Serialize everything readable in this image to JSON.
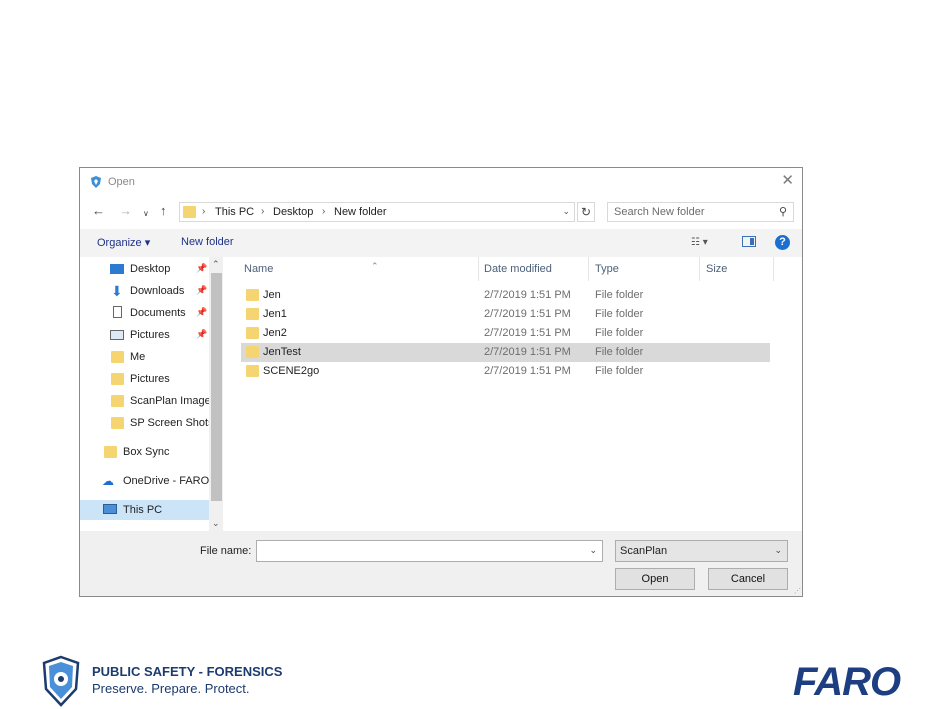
{
  "dialog": {
    "title": "Open",
    "breadcrumb": [
      "This PC",
      "Desktop",
      "New folder"
    ],
    "search_placeholder": "Search New folder",
    "toolbar": {
      "organize": "Organize",
      "new_folder": "New folder"
    },
    "nav_items": [
      {
        "label": "Desktop",
        "icon": "desktop-icon",
        "pinned": true
      },
      {
        "label": "Downloads",
        "icon": "download-arrow-icon",
        "pinned": true
      },
      {
        "label": "Documents",
        "icon": "document-icon",
        "pinned": true
      },
      {
        "label": "Pictures",
        "icon": "picture-icon",
        "pinned": true
      },
      {
        "label": "Me",
        "icon": "folder-icon",
        "pinned": false
      },
      {
        "label": "Pictures",
        "icon": "folder-icon",
        "pinned": false
      },
      {
        "label": "ScanPlan Images",
        "icon": "folder-icon",
        "pinned": false
      },
      {
        "label": "SP Screen Shots",
        "icon": "folder-icon",
        "pinned": false
      },
      {
        "label": "Box Sync",
        "icon": "folder-icon",
        "pinned": false
      },
      {
        "label": "OneDrive - FARO Technologies",
        "icon": "cloud-icon",
        "pinned": false
      },
      {
        "label": "This PC",
        "icon": "computer-icon",
        "pinned": false,
        "selected": true
      }
    ],
    "columns": [
      "Name",
      "Date modified",
      "Type",
      "Size"
    ],
    "files": [
      {
        "name": "Jen",
        "date": "2/7/2019 1:51 PM",
        "type": "File folder"
      },
      {
        "name": "Jen1",
        "date": "2/7/2019 1:51 PM",
        "type": "File folder"
      },
      {
        "name": "Jen2",
        "date": "2/7/2019 1:51 PM",
        "type": "File folder"
      },
      {
        "name": "JenTest",
        "date": "2/7/2019 1:51 PM",
        "type": "File folder",
        "selected": true
      },
      {
        "name": "SCENE2go",
        "date": "2/7/2019 1:51 PM",
        "type": "File folder"
      }
    ],
    "file_name_label": "File name:",
    "file_name_value": "",
    "file_type": "ScanPlan",
    "open_button": "Open",
    "cancel_button": "Cancel",
    "colors": {
      "folder": "#f5d571",
      "accent": "#1c6fd1",
      "selected_row": "#d9d9d9",
      "selected_nav": "#cce4f7"
    }
  },
  "branding": {
    "line1": "PUBLIC SAFETY - FORENSICS",
    "line2": "Preserve. Prepare. Protect.",
    "faro": "FARO",
    "color": "#1c3b6e"
  }
}
